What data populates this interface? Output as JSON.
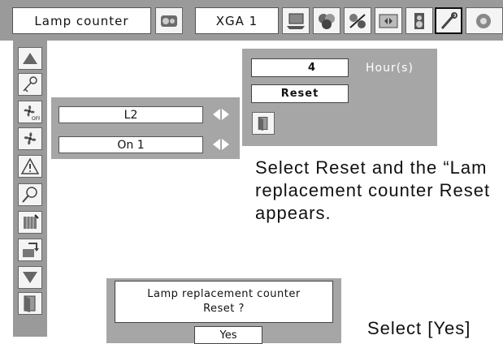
{
  "topbar": {
    "menu_title": "Lamp counter",
    "mode": "XGA 1",
    "icons": [
      "image-select-icon",
      "pc-adjust-icon",
      "image-adjust-icon",
      "color-adjust-icon",
      "screen-icon",
      "sound-icon",
      "setting-icon",
      "information-icon"
    ]
  },
  "sidebar": {
    "icons": [
      "up-arrow-icon",
      "key-icon",
      "fan-off-icon",
      "fan-icon",
      "warning-icon",
      "lamp-icon",
      "filter-icon",
      "filter-reset-icon",
      "down-arrow-icon",
      "exit-icon"
    ]
  },
  "submenu": {
    "lamp_selection": "L2",
    "lamp_mode": "On 1"
  },
  "lamp_counter": {
    "hours_value": "4",
    "hours_unit": "Hour(s)",
    "reset_label": "Reset"
  },
  "description": {
    "line1": "Select Reset and the “Lam",
    "line2": "replacement counter Reset",
    "line3": "appears."
  },
  "confirm_dialog": {
    "line1": "Lamp replacement counter",
    "line2": "Reset ?",
    "yes_label": "Yes"
  },
  "instruction": "Select [Yes]"
}
